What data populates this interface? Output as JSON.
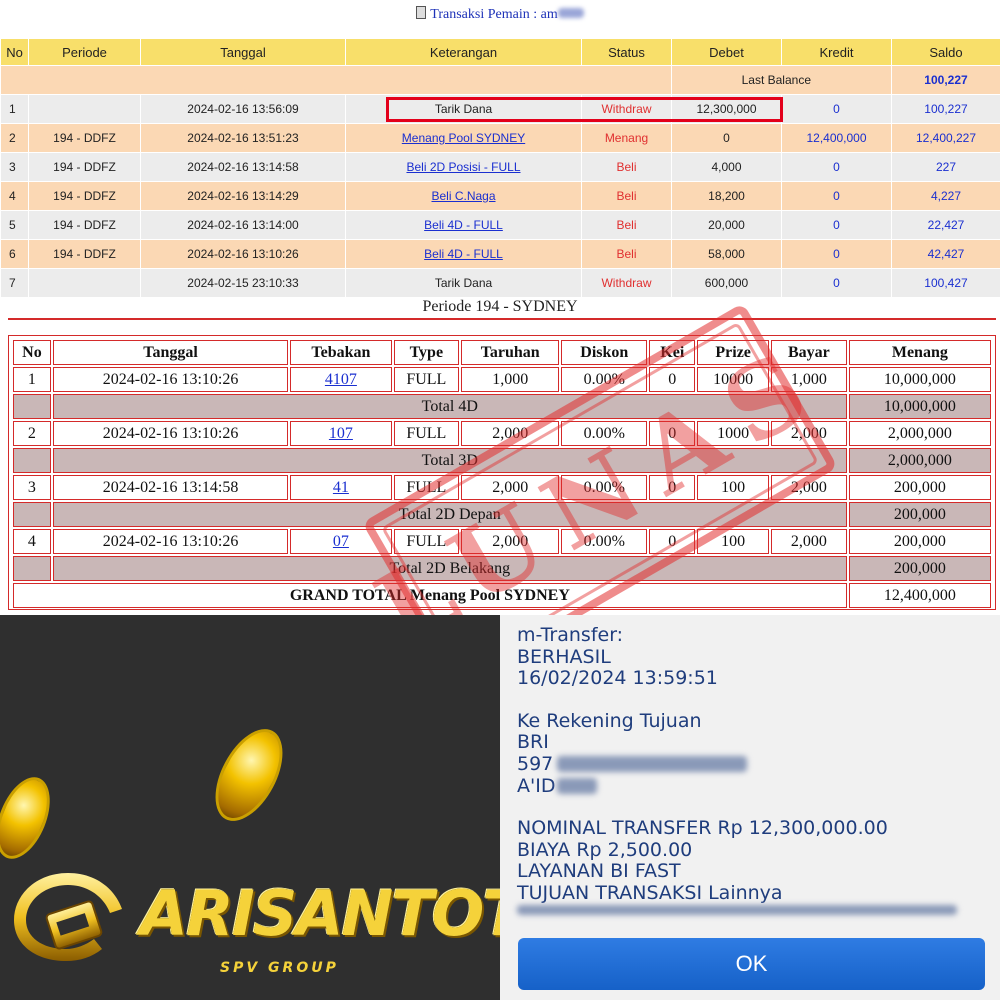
{
  "top": {
    "title": "Transaksi  Pemain : am",
    "headers": [
      "No",
      "Periode",
      "Tanggal",
      "Keterangan",
      "Status",
      "Debet",
      "Kredit",
      "Saldo"
    ],
    "last_balance_label": "Last Balance",
    "last_balance_value": "100,227",
    "rows": [
      {
        "no": "1",
        "periode": "",
        "tanggal": "2024-02-16 13:56:09",
        "keterangan": "Tarik Dana",
        "status": "Withdraw",
        "debet": "12,300,000",
        "kredit": "0",
        "saldo": "100,227"
      },
      {
        "no": "2",
        "periode": "194 - DDFZ",
        "tanggal": "2024-02-16 13:51:23",
        "keterangan": "Menang Pool SYDNEY",
        "status": "Menang",
        "debet": "0",
        "kredit": "12,400,000",
        "saldo": "12,400,227"
      },
      {
        "no": "3",
        "periode": "194 - DDFZ",
        "tanggal": "2024-02-16 13:14:58",
        "keterangan": "Beli 2D Posisi - FULL",
        "status": "Beli",
        "debet": "4,000",
        "kredit": "0",
        "saldo": "227"
      },
      {
        "no": "4",
        "periode": "194 - DDFZ",
        "tanggal": "2024-02-16 13:14:29",
        "keterangan": "Beli C.Naga",
        "status": "Beli",
        "debet": "18,200",
        "kredit": "0",
        "saldo": "4,227"
      },
      {
        "no": "5",
        "periode": "194 - DDFZ",
        "tanggal": "2024-02-16 13:14:00",
        "keterangan": "Beli 4D - FULL",
        "status": "Beli",
        "debet": "20,000",
        "kredit": "0",
        "saldo": "22,427"
      },
      {
        "no": "6",
        "periode": "194 - DDFZ",
        "tanggal": "2024-02-16 13:10:26",
        "keterangan": "Beli 4D - FULL",
        "status": "Beli",
        "debet": "58,000",
        "kredit": "0",
        "saldo": "42,427"
      },
      {
        "no": "7",
        "periode": "",
        "tanggal": "2024-02-15 23:10:33",
        "keterangan": "Tarik Dana",
        "status": "Withdraw",
        "debet": "600,000",
        "kredit": "0",
        "saldo": "100,427"
      }
    ]
  },
  "periode": {
    "title": "Periode 194 - SYDNEY",
    "headers": [
      "No",
      "Tanggal",
      "Tebakan",
      "Type",
      "Taruhan",
      "Diskon",
      "Kei",
      "Prize",
      "Bayar",
      "Menang"
    ],
    "bets": [
      {
        "no": "1",
        "tanggal": "2024-02-16 13:10:26",
        "tebakan": "4107",
        "type": "FULL",
        "taruhan": "1,000",
        "diskon": "0.00%",
        "kei": "0",
        "prize": "10000",
        "bayar": "1,000",
        "menang": "10,000,000",
        "total_label": "Total 4D",
        "total_value": "10,000,000"
      },
      {
        "no": "2",
        "tanggal": "2024-02-16 13:10:26",
        "tebakan": "107",
        "type": "FULL",
        "taruhan": "2,000",
        "diskon": "0.00%",
        "kei": "0",
        "prize": "1000",
        "bayar": "2,000",
        "menang": "2,000,000",
        "total_label": "Total 3D",
        "total_value": "2,000,000"
      },
      {
        "no": "3",
        "tanggal": "2024-02-16 13:14:58",
        "tebakan": "41",
        "type": "FULL",
        "taruhan": "2,000",
        "diskon": "0.00%",
        "kei": "0",
        "prize": "100",
        "bayar": "2,000",
        "menang": "200,000",
        "total_label": "Total 2D Depan",
        "total_value": "200,000"
      },
      {
        "no": "4",
        "tanggal": "2024-02-16 13:10:26",
        "tebakan": "07",
        "type": "FULL",
        "taruhan": "2,000",
        "diskon": "0.00%",
        "kei": "0",
        "prize": "100",
        "bayar": "2,000",
        "menang": "200,000",
        "total_label": "Total 2D Belakang",
        "total_value": "200,000"
      }
    ],
    "grand_total_label": "GRAND TOTAL  Menang Pool SYDNEY",
    "grand_total_value": "12,400,000",
    "stamp_text": "LUNAS"
  },
  "promo": {
    "brand": "ARISANTOTO",
    "sub": "SPV GROUP"
  },
  "transfer": {
    "line1": "m-Transfer:",
    "line2": "BERHASIL",
    "line3": "16/02/2024 13:59:51",
    "line4": "Ke Rekening Tujuan",
    "line5": "BRI",
    "account_prefix": "597",
    "name_prefix": "A'ID",
    "line8": "NOMINAL TRANSFER Rp 12,300,000.00",
    "line9": "BIAYA Rp 2,500.00",
    "line10": "LAYANAN BI FAST",
    "line11": "TUJUAN TRANSAKSI Lainnya",
    "ok_label": "OK"
  },
  "colors": {
    "header_yellow": "#f8df6a",
    "row_peach": "#fbd8b4",
    "row_gray": "#ececec",
    "link_blue": "#1a2fd0",
    "status_red": "#e03030",
    "border_red": "#d42a2a",
    "highlight_red": "#e3001b",
    "promo_bg": "#2f2f2f",
    "gold": "#f5d23a",
    "transfer_text": "#1f3d7d",
    "ok_blue": "#1f6fd6"
  }
}
